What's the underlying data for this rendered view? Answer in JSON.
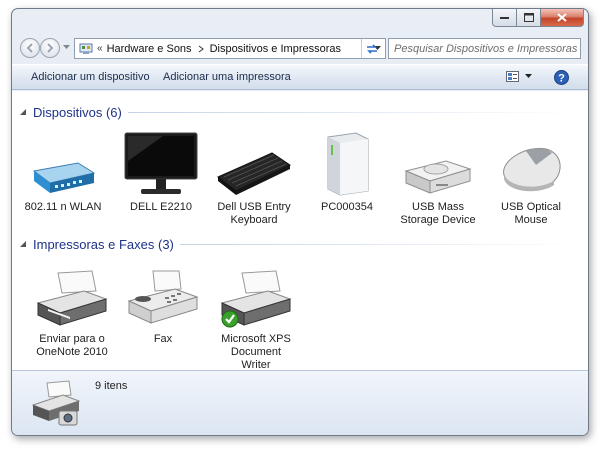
{
  "window": {
    "caption_buttons": [
      "minimize",
      "maximize",
      "close"
    ]
  },
  "nav": {
    "breadcrumb": [
      "Hardware e Sons",
      "Dispositivos e Impressoras"
    ],
    "overflow_marker": "«",
    "search_placeholder": "Pesquisar Dispositivos e Impressoras"
  },
  "toolbar": {
    "add_device": "Adicionar um dispositivo",
    "add_printer": "Adicionar uma impressora"
  },
  "groups": [
    {
      "title": "Dispositivos (6)",
      "items": [
        {
          "label": "802.11 n WLAN",
          "icon": "router-icon"
        },
        {
          "label": "DELL E2210",
          "icon": "monitor-icon"
        },
        {
          "label": "Dell USB Entry Keyboard",
          "icon": "keyboard-icon"
        },
        {
          "label": "PC000354",
          "icon": "computer-icon"
        },
        {
          "label": "USB Mass Storage Device",
          "icon": "drive-icon"
        },
        {
          "label": "USB Optical Mouse",
          "icon": "mouse-icon"
        }
      ]
    },
    {
      "title": "Impressoras e Faxes (3)",
      "items": [
        {
          "label": "Enviar para o OneNote 2010",
          "icon": "printer-icon"
        },
        {
          "label": "Fax",
          "icon": "fax-icon"
        },
        {
          "label": "Microsoft XPS Document Writer",
          "icon": "printer-default-icon"
        }
      ]
    }
  ],
  "details": {
    "count": "9 itens"
  },
  "colors": {
    "group_title": "#1e3287",
    "toolbar_text": "#1b2d4c",
    "default_check": "#3aa12c"
  }
}
